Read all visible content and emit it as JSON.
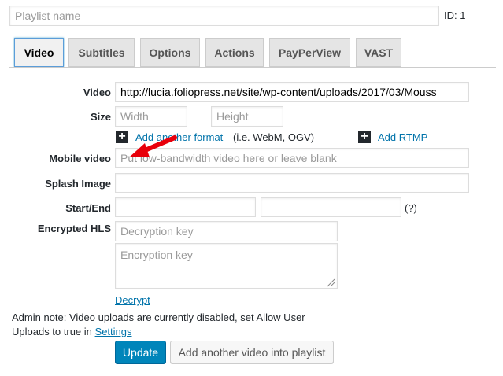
{
  "playlist": {
    "name_placeholder": "Playlist name",
    "id_label": "ID: 1"
  },
  "tabs": [
    {
      "label": "Video"
    },
    {
      "label": "Subtitles"
    },
    {
      "label": "Options"
    },
    {
      "label": "Actions"
    },
    {
      "label": "PayPerView"
    },
    {
      "label": "VAST"
    }
  ],
  "form": {
    "video_label": "Video",
    "video_value": "http://lucia.foliopress.net/site/wp-content/uploads/2017/03/Mouss",
    "size_label": "Size",
    "width_placeholder": "Width",
    "height_placeholder": "Height",
    "add_format_link": "Add another format",
    "add_format_hint": "(i.e. WebM, OGV)",
    "add_rtmp_link": "Add RTMP",
    "mobile_label": "Mobile video",
    "mobile_placeholder": "Put low-bandwidth video here or leave blank",
    "splash_label": "Splash Image",
    "startend_label": "Start/End",
    "help_marker": "(?)",
    "hls_label": "Encrypted HLS",
    "decryption_placeholder": "Decryption key",
    "encryption_placeholder": "Encryption key",
    "decrypt_link": "Decrypt"
  },
  "admin_note": {
    "line1": "Admin note: Video uploads are currently disabled, set Allow User",
    "line2_prefix": "Uploads to true in",
    "settings_link": "Settings"
  },
  "buttons": {
    "update": "Update",
    "add_video": "Add another video into playlist"
  },
  "colors": {
    "primary_button": "#0085ba",
    "link": "#0073aa",
    "annotation_arrow": "#e8000b"
  }
}
